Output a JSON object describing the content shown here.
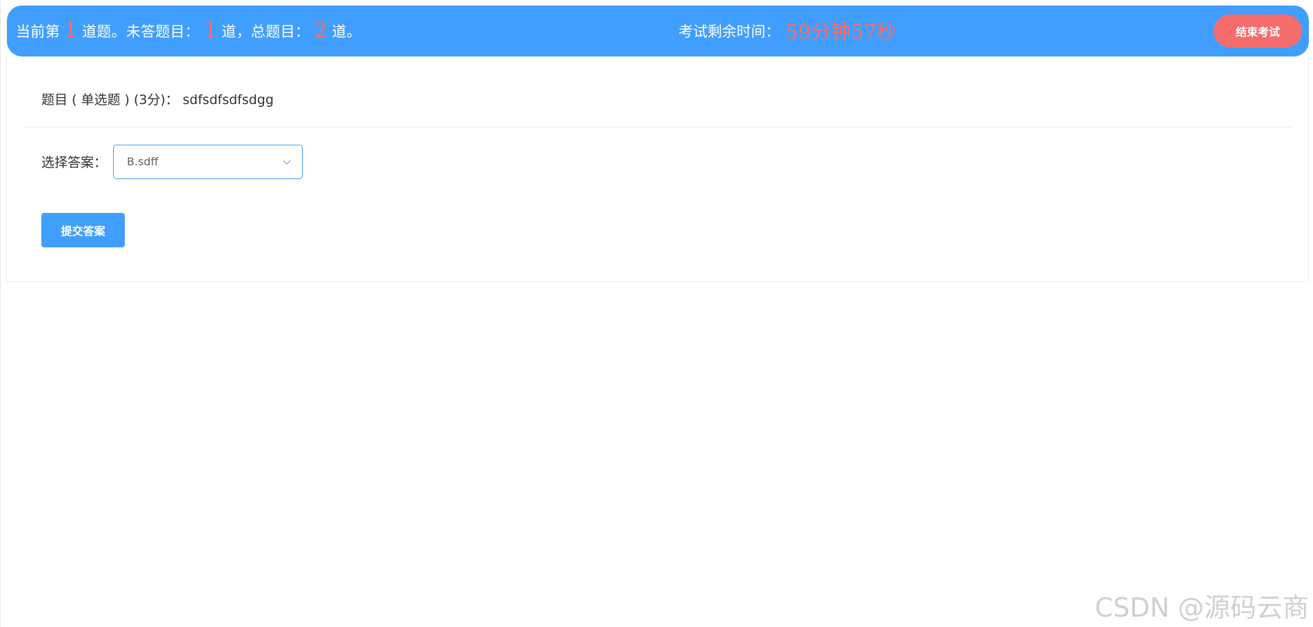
{
  "header": {
    "prefix_current": "当前第",
    "current_number": "1",
    "suffix_current": "道题。未答题目：",
    "unanswered_number": "1",
    "suffix_unanswered": "道，总题目：",
    "total_number": "2",
    "suffix_total": "道。",
    "time_label": "考试剩余时间：",
    "time_value": "59分钟57秒",
    "end_button_label": "结束考试"
  },
  "question": {
    "label": "题目 ( 单选题 ) (3分)：",
    "content": "sdfsdfsdfsdgg"
  },
  "answer": {
    "label": "选择答案：",
    "selected_value": "B.sdff"
  },
  "submit_label": "提交答案",
  "watermark": "CSDN @源码云商",
  "colors": {
    "primary": "#409eff",
    "danger": "#f56c6c"
  }
}
